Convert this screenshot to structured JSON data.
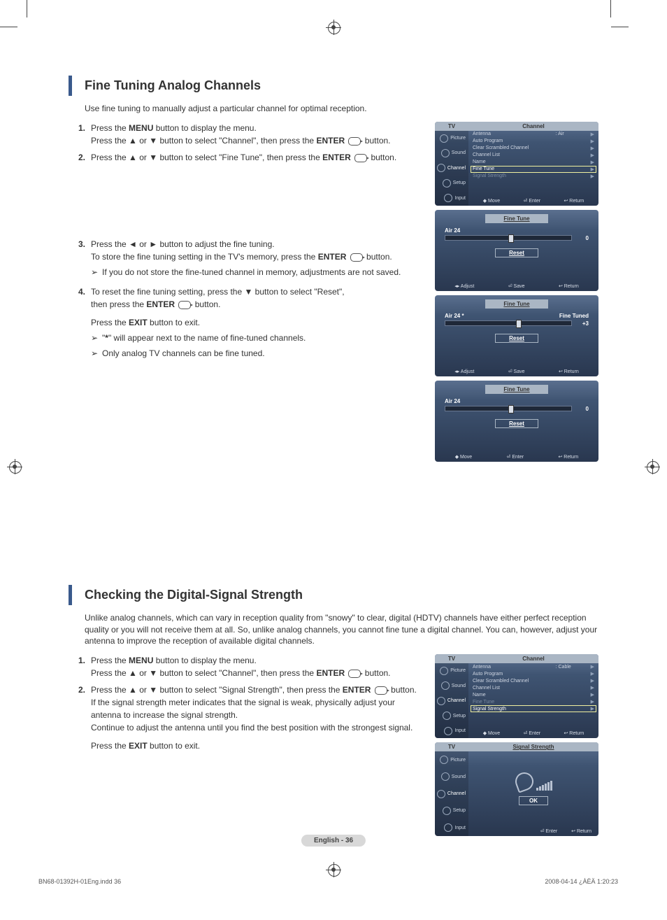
{
  "section1": {
    "title": "Fine Tuning Analog Channels",
    "intro": "Use fine tuning to manually adjust a particular channel for optimal reception.",
    "steps": [
      {
        "n": "1.",
        "body": "Press the <b>MENU</b> button to display the menu.<br>Press the ▲ or ▼ button to select \"Channel\", then press the <b>ENTER</b> <span class=\"enter-ic\"></span> button."
      },
      {
        "n": "2.",
        "body": "Press the ▲ or ▼ button to select \"Fine Tune\", then press the <b>ENTER</b> <span class=\"enter-ic\"></span> button."
      },
      {
        "n": "3.",
        "body": "Press the ◄ or ► button to adjust the fine tuning.<br>To store the fine tuning setting in the TV's memory, press the <b>ENTER</b> <span class=\"enter-ic\"></span> button.",
        "notes": [
          "If you do not store the fine-tuned channel in memory, adjustments are not saved."
        ]
      },
      {
        "n": "4.",
        "body": "To reset the fine tuning setting, press the ▼ button to select \"Reset\",<br>then press  the <b>ENTER</b> <span class=\"enter-ic\"></span> button.",
        "after": "Press the <b>EXIT</b> button to exit.",
        "notes": [
          "\"<b>*</b>\" will appear next to the name of fine-tuned channels.",
          "Only analog TV channels can be fine tuned."
        ]
      }
    ]
  },
  "section2": {
    "title": "Checking the Digital-Signal Strength",
    "intro": "Unlike analog channels, which can vary in reception quality from \"snowy\" to clear, digital (HDTV) channels have either perfect reception quality or you will not receive them at all. So, unlike analog channels, you cannot fine tune a digital channel. You can, however, adjust your antenna to improve the reception of available digital channels.",
    "steps": [
      {
        "n": "1.",
        "body": "Press the <b>MENU</b> button to display the menu.<br>Press the ▲ or ▼ button to select \"Channel\", then press the <b>ENTER</b> <span class=\"enter-ic\"></span> button."
      },
      {
        "n": "2.",
        "body": "Press the ▲ or ▼ button to select \"Signal Strength\", then press the <b>ENTER</b> <span class=\"enter-ic\"></span> button.<br>If the signal strength meter indicates that the signal is weak, physically adjust your antenna to increase the signal strength.<br>Continue to adjust the antenna until you find the best position with the strongest signal.",
        "after": "Press the <b>EXIT</b> button to exit."
      }
    ]
  },
  "osd": {
    "side": {
      "tv": "TV",
      "items": [
        "Picture",
        "Sound",
        "Channel",
        "Setup",
        "Input"
      ]
    },
    "channelHdr": "Channel",
    "menu1": {
      "rows": [
        {
          "lbl": "Antenna",
          "val": ": Air"
        },
        {
          "lbl": "Auto Program"
        },
        {
          "lbl": "Clear Scrambled Channel"
        },
        {
          "lbl": "Channel List"
        },
        {
          "lbl": "Name"
        },
        {
          "lbl": "Fine Tune",
          "hi": true
        },
        {
          "lbl": "Signal Strength",
          "dim": true
        }
      ],
      "foot": [
        "◆ Move",
        "⏎ Enter",
        "↩ Return"
      ]
    },
    "ft": [
      {
        "title": "Fine Tune",
        "ch": "Air 24",
        "val": "0",
        "thumb": 50,
        "reset": "Reset",
        "foot": [
          "◂▸ Adjust",
          "⏎ Save",
          "↩ Return"
        ]
      },
      {
        "title": "Fine Tune",
        "ch": "Air 24 *",
        "status": "Fine Tuned",
        "val": "+3",
        "thumb": 56,
        "reset": "Reset",
        "foot": [
          "◂▸ Adjust",
          "⏎ Save",
          "↩ Return"
        ]
      },
      {
        "title": "Fine Tune",
        "ch": "Air 24",
        "val": "0",
        "thumb": 50,
        "reset": "Reset",
        "foot": [
          "◆ Move",
          "⏎ Enter",
          "↩ Return"
        ]
      }
    ],
    "menu2": {
      "rows": [
        {
          "lbl": "Antenna",
          "val": ": Cable"
        },
        {
          "lbl": "Auto Program"
        },
        {
          "lbl": "Clear Scrambled Channel"
        },
        {
          "lbl": "Channel List"
        },
        {
          "lbl": "Name"
        },
        {
          "lbl": "Fine Tune",
          "dim": true
        },
        {
          "lbl": "Signal Strength",
          "hi": true
        }
      ],
      "foot": [
        "◆ Move",
        "⏎ Enter",
        "↩ Return"
      ]
    },
    "ss": {
      "title": "Signal Strength",
      "ok": "OK",
      "foot": [
        "⏎ Enter",
        "↩ Return"
      ]
    }
  },
  "footer": {
    "page": "English - 36",
    "doc": "BN68-01392H-01Eng.indd   36",
    "ts": "2008-04-14   ¿ÀÈÄ 1:20:23"
  }
}
